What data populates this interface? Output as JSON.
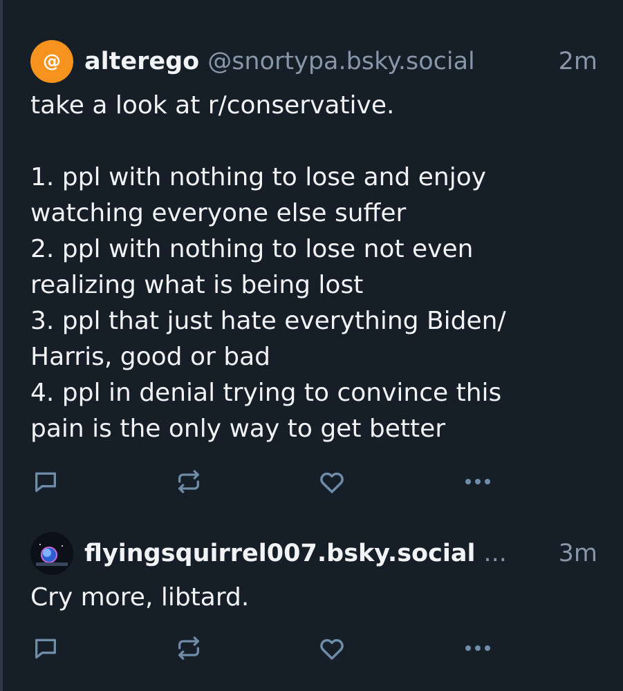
{
  "posts": [
    {
      "avatar_icon": "@",
      "display_name": "alterego",
      "handle": "@snortypa.bsky.social",
      "time": "2m",
      "text": "take a look at r/conservative.\n\n1. ppl with nothing to lose and enjoy watching everyone else suffer\n2. ppl with nothing to lose not even realizing what is being lost\n3. ppl that just hate everything Biden/ Harris, good or bad\n4. ppl in denial trying to convince this pain is the only way to get better"
    },
    {
      "display_name": "flyingsquirrel007.bsky.social",
      "handle": "...",
      "time": "3m",
      "text": "Cry more, libtard."
    }
  ],
  "action_icons": [
    "reply-icon",
    "repost-icon",
    "like-icon",
    "more-icon"
  ],
  "colors": {
    "background": "#161e27",
    "text": "#f1f3f5",
    "muted": "#8796a8",
    "icon": "#6f8ca8",
    "avatar_orange": "#f5931e"
  }
}
